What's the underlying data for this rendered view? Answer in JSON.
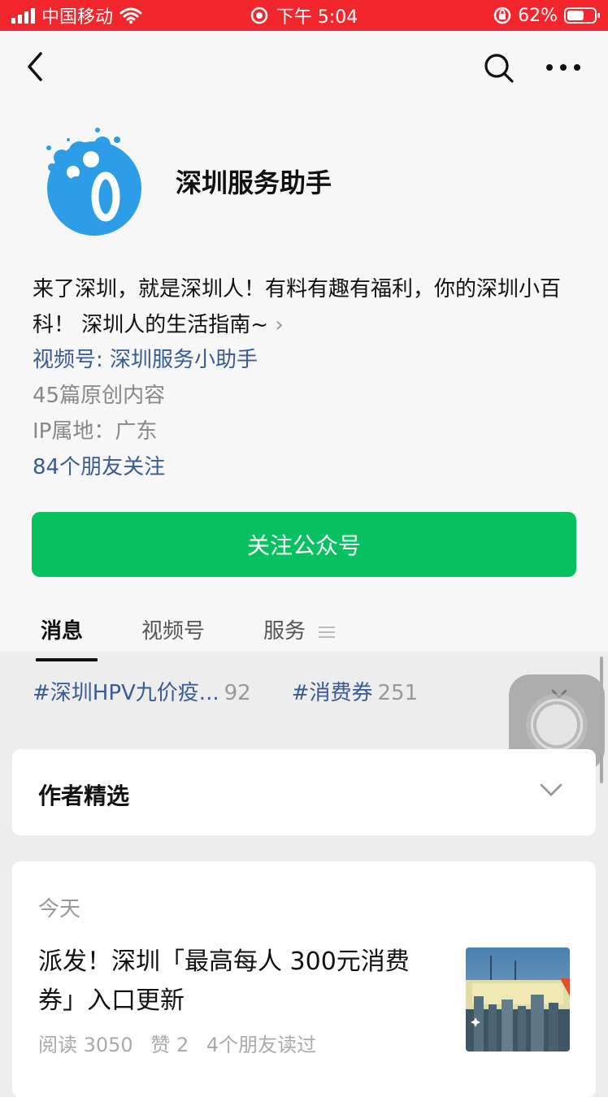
{
  "status_bar": {
    "carrier": "中国移动",
    "time": "下午 5:04",
    "battery": "62%",
    "battery_level": 0.62
  },
  "nav": {
    "icons": [
      "back-arrow-icon",
      "search-icon",
      "more-icon"
    ]
  },
  "account": {
    "name": "深圳服务助手",
    "description": "来了深圳，就是深圳人！有料有趣有福利，你的深圳小百科！ 深圳人的生活指南~",
    "video_channel": "视频号: 深圳服务小助手",
    "original_count": "45篇原创内容",
    "ip_location": "IP属地：广东",
    "friends_following": "84个朋友关注",
    "follow_button": "关注公众号",
    "brand_color": "#07c160"
  },
  "tabs": [
    {
      "label": "消息",
      "active": true
    },
    {
      "label": "视频号",
      "active": false
    },
    {
      "label": "服务",
      "active": false
    }
  ],
  "hashtags": [
    {
      "tag": "#深圳HPV九价疫...",
      "count": "92"
    },
    {
      "tag": "#消费券",
      "count": "251"
    }
  ],
  "picks": {
    "title": "作者精选"
  },
  "article": {
    "date": "今天",
    "title": "派发！深圳「最高每人 300元消费券」入口更新",
    "reads": "阅读 3050",
    "likes": "赞 2",
    "friends_read": "4个朋友读过"
  }
}
